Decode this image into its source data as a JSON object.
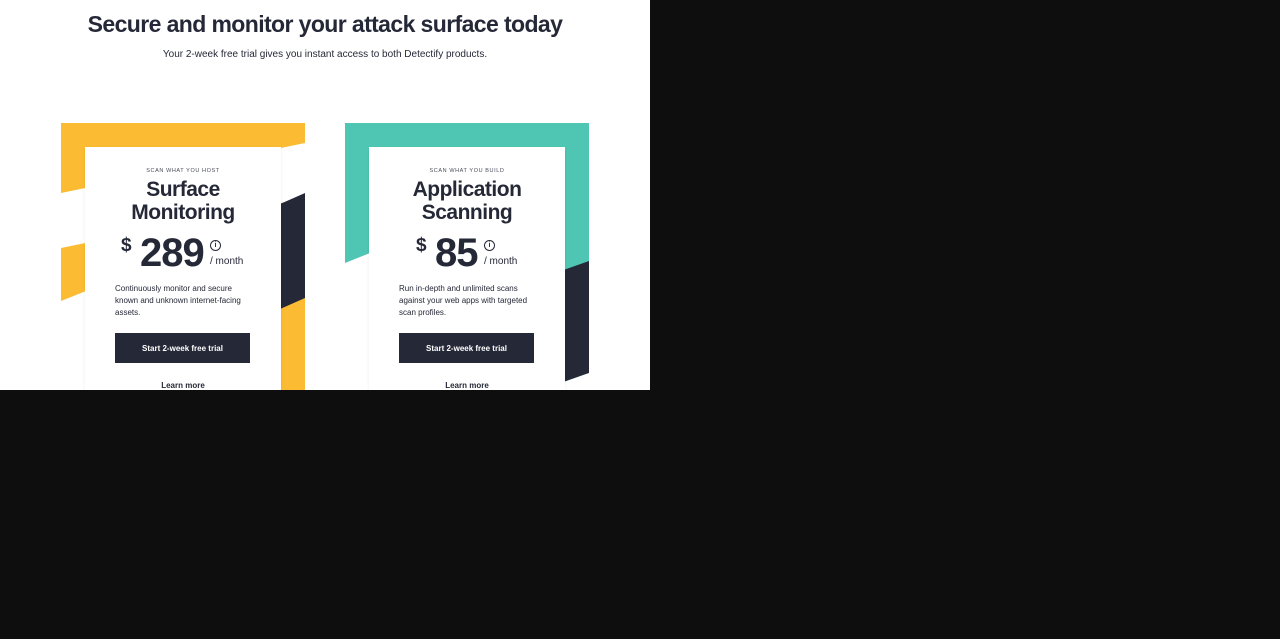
{
  "hero": {
    "title": "Secure and monitor your attack surface today",
    "subtitle": "Your 2-week free trial gives you instant access to both Detectify products."
  },
  "cards": [
    {
      "eyebrow": "SCAN WHAT YOU HOST",
      "title_line1": "Surface",
      "title_line2": "Monitoring",
      "currency": "$",
      "price": "289",
      "info_glyph": "i",
      "period": "/ month",
      "description": "Continuously monitor and secure known and unknown internet-facing assets.",
      "cta_label": "Start 2-week free trial",
      "learn_more_label": "Learn more",
      "accent_color": "#fbbb33"
    },
    {
      "eyebrow": "SCAN WHAT YOU BUILD",
      "title_line1": "Application",
      "title_line2": "Scanning",
      "currency": "$",
      "price": "85",
      "info_glyph": "i",
      "period": "/ month",
      "description": "Run in-depth and unlimited scans against your web apps with targeted scan profiles.",
      "cta_label": "Start 2-week free trial",
      "learn_more_label": "Learn more",
      "accent_color": "#4fc6b3"
    }
  ],
  "colors": {
    "ink": "#252837",
    "page_background": "#ffffff",
    "outer_background": "#0e0e0f",
    "stripe_dark": "#252837"
  },
  "icons": {
    "info": "info-circle-icon"
  }
}
